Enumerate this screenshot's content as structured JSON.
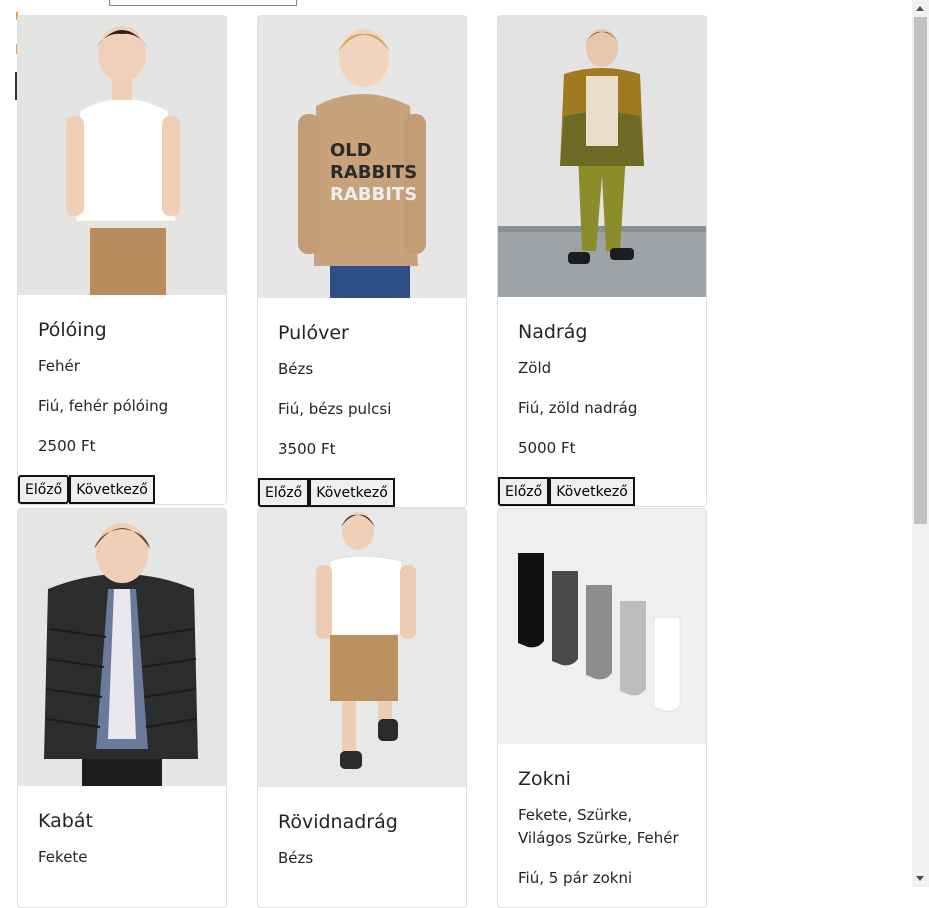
{
  "products": [
    {
      "name": "Pólóing",
      "color": "Fehér",
      "desc": "Fiú, fehér pólóing",
      "price": "2500 Ft",
      "prev": "Előző",
      "next": "Következő"
    },
    {
      "name": "Pulóver",
      "color": "Bézs",
      "desc": "Fiú, bézs pulcsi",
      "price": "3500 Ft",
      "prev": "Előző",
      "next": "Következő"
    },
    {
      "name": "Nadrág",
      "color": "Zöld",
      "desc": "Fiú, zöld nadrág",
      "price": "5000 Ft",
      "prev": "Előző",
      "next": "Következő"
    },
    {
      "name": "Kabát",
      "color": "Fekete"
    },
    {
      "name": "Rövidnadrág",
      "color": "Bézs"
    },
    {
      "name": "Zokni",
      "color": "Fekete, Szürke, Világos Szürke, Fehér",
      "desc": "Fiú, 5 pár zokni"
    }
  ],
  "image_icons": [
    "boy-white-polo-photo",
    "boy-beige-sweater-photo",
    "boy-green-pants-photo",
    "boy-black-jacket-photo",
    "boy-beige-shorts-photo",
    "socks-photo"
  ]
}
